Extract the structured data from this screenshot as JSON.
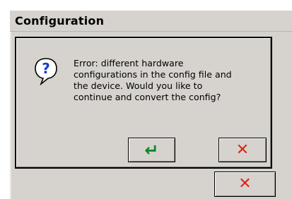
{
  "window": {
    "title": "Configuration"
  },
  "dialog": {
    "icon": "question-icon",
    "message": "Error: different hardware\nconfigurations in the config file and\nthe device. Would you like to\ncontinue and convert the config?",
    "ok_icon": "enter-arrow-icon",
    "ok_glyph": "↵",
    "cancel_icon": "red-x-icon",
    "cancel_glyph": "✕"
  },
  "background": {
    "cancel_icon": "red-x-icon",
    "cancel_glyph": "✕"
  },
  "colors": {
    "ok_green": "#0a8a2a",
    "cancel_red": "#e0231b",
    "icon_blue": "#1a3cc8",
    "panel_gray": "#d6d3ce"
  }
}
